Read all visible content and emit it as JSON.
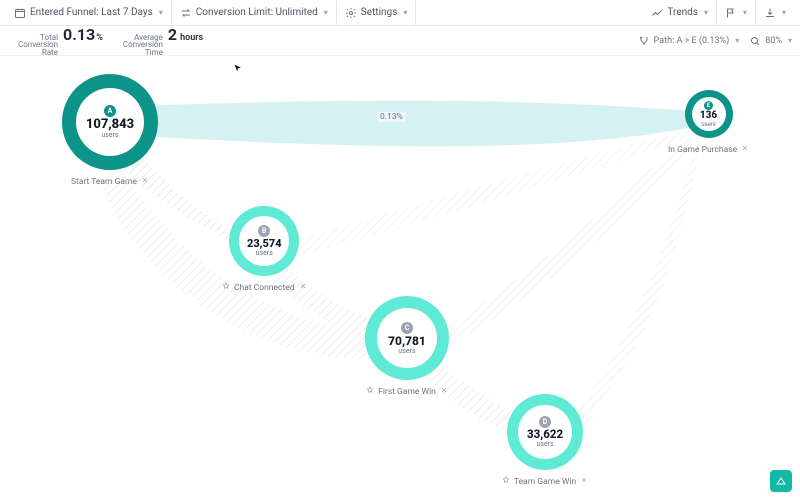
{
  "toolbar": {
    "entered_funnel_label": "Entered Funnel: Last 7 Days",
    "conversion_limit_label": "Conversion Limit: Unlimited",
    "settings_label": "Settings",
    "trends_label": "Trends"
  },
  "metrics": {
    "total_conv_label_l1": "Total",
    "total_conv_label_l2": "Conversion",
    "total_conv_label_l3": "Rate",
    "total_conv_value": "0.13",
    "total_conv_unit": "%",
    "avg_conv_label_l1": "Average",
    "avg_conv_label_l2": "Conversion",
    "avg_conv_label_l3": "Time",
    "avg_conv_value": "2",
    "avg_conv_unit": "hours",
    "path_chip": "Path: A > E (0.13%)",
    "zoom_chip": "80%"
  },
  "flow_label_ae": "0.13%",
  "nodes": {
    "a": {
      "letter": "A",
      "value": "107,843",
      "users": "users",
      "caption": "Start Team Game"
    },
    "b": {
      "letter": "B",
      "value": "23,574",
      "users": "users",
      "caption": "Chat Connected"
    },
    "c": {
      "letter": "C",
      "value": "70,781",
      "users": "users",
      "caption": "First Game Win"
    },
    "d": {
      "letter": "D",
      "value": "33,622",
      "users": "users",
      "caption": "Team Game Win"
    },
    "e": {
      "letter": "E",
      "value": "136",
      "users": "users",
      "caption": "In Game Purchase"
    }
  },
  "colors": {
    "dark_teal": "#0d9488",
    "light_teal": "#5eead4",
    "flow_fill": "#c7eef2",
    "hatch": "#e5e7eb"
  }
}
